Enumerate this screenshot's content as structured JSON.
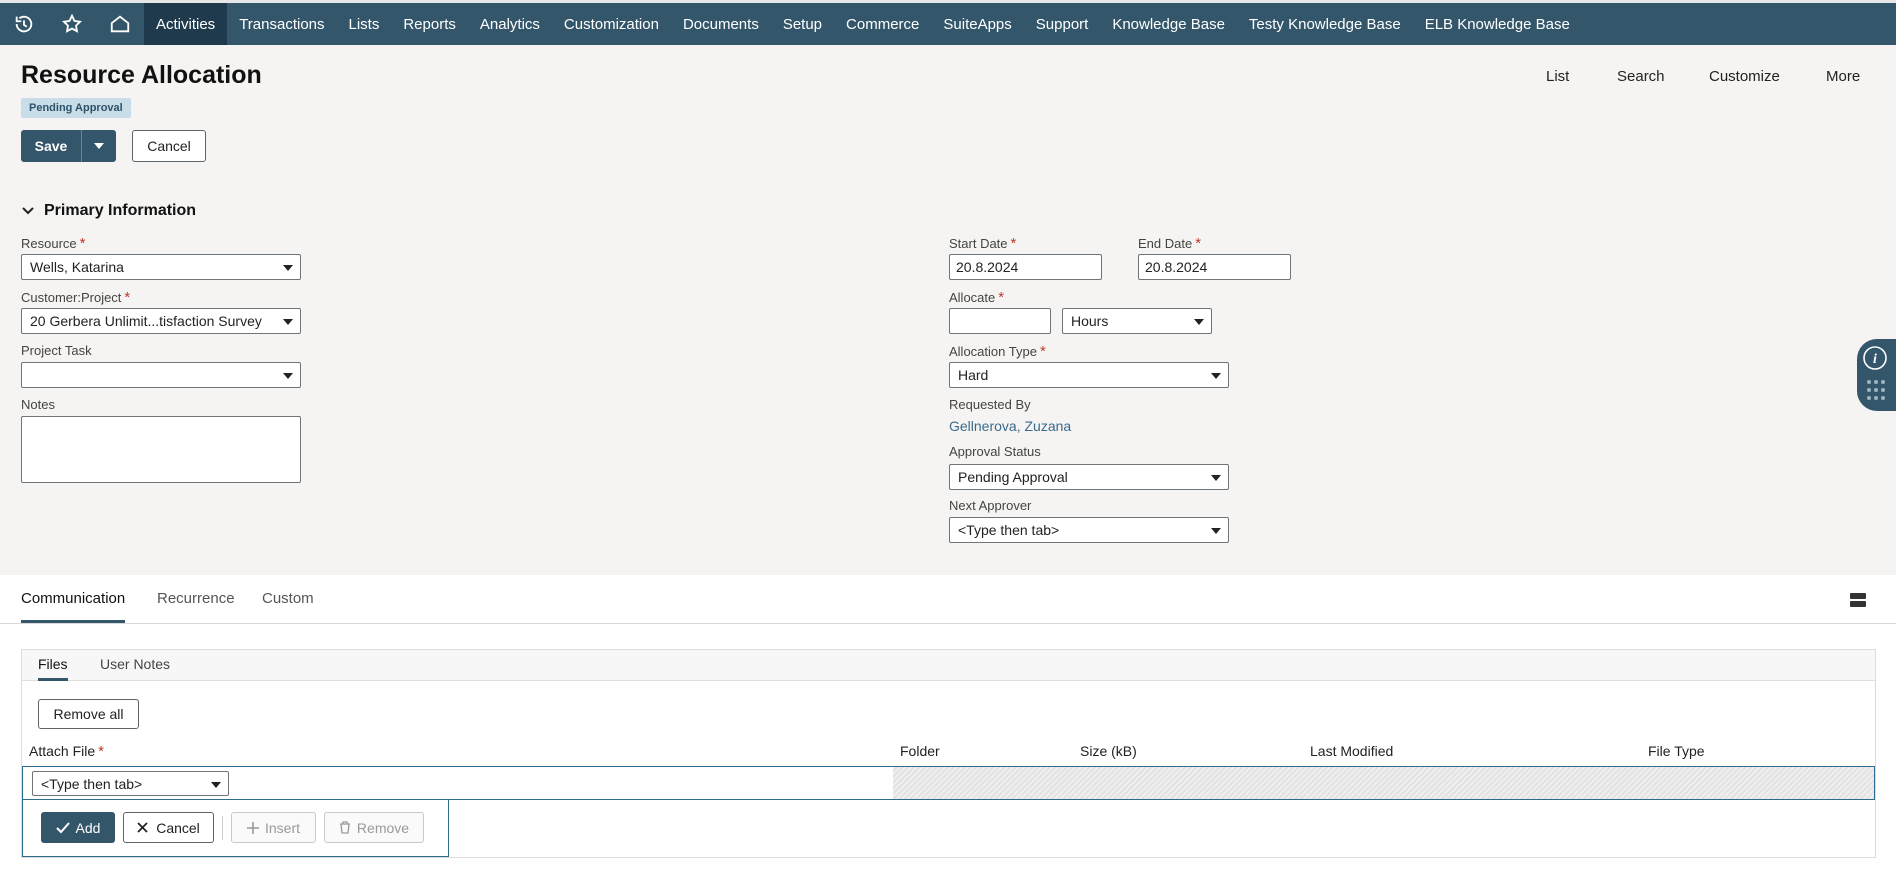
{
  "nav": {
    "icons": [
      "recent-icon",
      "star-icon",
      "home-icon"
    ],
    "items": [
      "Activities",
      "Transactions",
      "Lists",
      "Reports",
      "Analytics",
      "Customization",
      "Documents",
      "Setup",
      "Commerce",
      "SuiteApps",
      "Support",
      "Knowledge Base",
      "Testy Knowledge Base",
      "ELB Knowledge Base"
    ],
    "active": "Activities"
  },
  "header": {
    "title": "Resource Allocation",
    "status": "Pending Approval",
    "links": [
      "List",
      "Search",
      "Customize",
      "More"
    ]
  },
  "actions": {
    "save": "Save",
    "cancel": "Cancel"
  },
  "primary": {
    "section_title": "Primary Information",
    "resource_label": "Resource",
    "resource_value": "Wells, Katarina",
    "customer_label": "Customer:Project",
    "customer_value": "20 Gerbera Unlimit...tisfaction Survey",
    "task_label": "Project Task",
    "task_value": "",
    "notes_label": "Notes",
    "start_label": "Start Date",
    "start_value": "20.8.2024",
    "end_label": "End Date",
    "end_value": "20.8.2024",
    "allocate_label": "Allocate",
    "allocate_value": "",
    "allocate_unit": "Hours",
    "alloc_type_label": "Allocation Type",
    "alloc_type_value": "Hard",
    "requested_label": "Requested By",
    "requested_value": "Gellnerova, Zuzana",
    "approval_label": "Approval Status",
    "approval_value": "Pending Approval",
    "next_label": "Next Approver",
    "next_value": "<Type then tab>"
  },
  "tabs": {
    "items": [
      "Communication",
      "Recurrence",
      "Custom"
    ],
    "active": "Communication"
  },
  "files": {
    "subtabs": [
      "Files",
      "User Notes"
    ],
    "active": "Files",
    "remove_all": "Remove all",
    "columns": [
      "Attach File",
      "Folder",
      "Size (kB)",
      "Last Modified",
      "File Type"
    ],
    "attach_value": "<Type then tab>",
    "buttons": {
      "add": "Add",
      "cancel": "Cancel",
      "insert": "Insert",
      "remove": "Remove"
    }
  },
  "colors": {
    "nav": "#33566a",
    "nav_active": "#1e3a4c",
    "required": "#c0392b",
    "link": "#3a6a8c"
  }
}
